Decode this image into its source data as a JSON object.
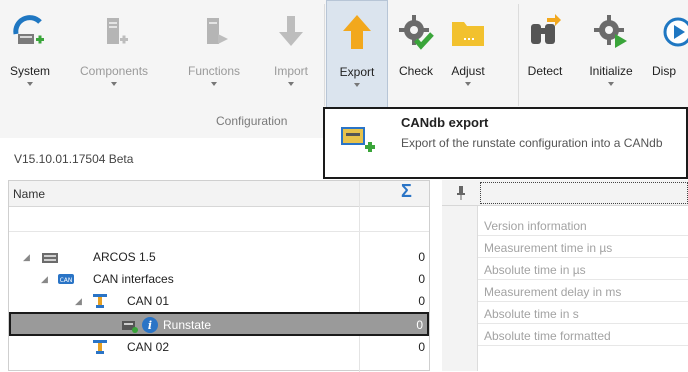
{
  "ribbon": {
    "buttons": [
      {
        "label": "System",
        "icon": "system-icon",
        "dropdown": true,
        "disabled": false
      },
      {
        "label": "Components",
        "icon": "components-icon",
        "dropdown": true,
        "disabled": true
      },
      {
        "label": "Functions",
        "icon": "functions-icon",
        "dropdown": true,
        "disabled": true
      },
      {
        "label": "Import",
        "icon": "import-icon",
        "dropdown": true,
        "disabled": true
      },
      {
        "label": "Export",
        "icon": "export-icon",
        "dropdown": true,
        "disabled": false,
        "pressed": true
      },
      {
        "label": "Check",
        "icon": "check-icon",
        "dropdown": false,
        "disabled": false
      },
      {
        "label": "Adjust",
        "icon": "adjust-icon",
        "dropdown": true,
        "disabled": false
      },
      {
        "label": "Detect",
        "icon": "detect-icon",
        "dropdown": false,
        "disabled": false
      },
      {
        "label": "Initialize",
        "icon": "initialize-icon",
        "dropdown": true,
        "disabled": false
      },
      {
        "label": "Disp",
        "icon": "display-icon",
        "dropdown": false,
        "disabled": false
      }
    ],
    "group_label": "Configuration"
  },
  "status": {
    "version": "V15.10.01.17504 Beta"
  },
  "tooltip": {
    "title": "CANdb export",
    "description": "Export of the runstate configuration into a CANdb",
    "icon": "candb-export-icon"
  },
  "tree": {
    "col_name": "Name",
    "col_sum": "Σ",
    "rows": [
      {
        "label": "ARCOS 1.5",
        "value": "0",
        "icon": "device-icon",
        "expanded": true,
        "selected": false
      },
      {
        "label": "CAN interfaces",
        "value": "0",
        "icon": "can-interface-icon",
        "expanded": true,
        "selected": false
      },
      {
        "label": "CAN 01",
        "value": "0",
        "icon": "can-bus-icon",
        "expanded": true,
        "selected": false
      },
      {
        "label": "Runstate",
        "value": "0",
        "icon": "runstate-info-icon",
        "expanded": false,
        "selected": true
      },
      {
        "label": "CAN 02",
        "value": "0",
        "icon": "can-bus-icon",
        "expanded": false,
        "selected": false
      }
    ]
  },
  "rpanel": {
    "pin": "📌",
    "rows": [
      "Version information",
      "Measurement time in µs",
      "Absolute time in µs",
      "Measurement delay in ms",
      "Absolute time in s",
      "Absolute time formatted"
    ]
  },
  "colors": {
    "accent": "#2a74c6",
    "pressed_bg": "#dbe4ee",
    "selection": "#9a9a9a",
    "green": "#3aa53a",
    "orange": "#f2a81d"
  }
}
